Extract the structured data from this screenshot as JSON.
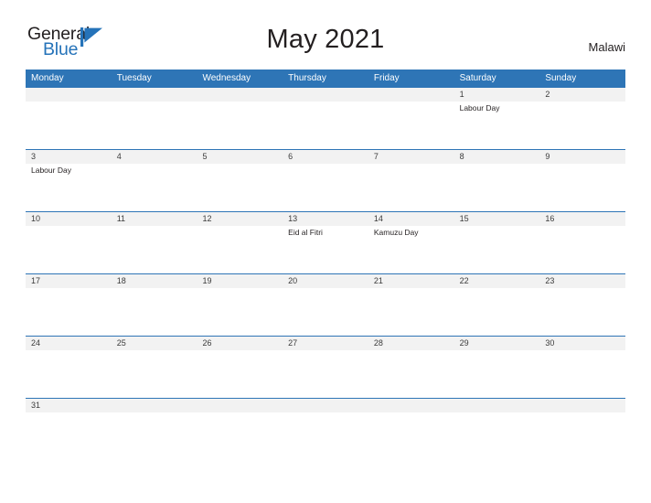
{
  "logo": {
    "word_one": "General",
    "word_two": "Blue",
    "flag_icon": "flag-triangle-icon",
    "dark_color": "#231f20",
    "blue_color": "#2573b9"
  },
  "header": {
    "title": "May 2021",
    "country": "Malawi"
  },
  "theme": {
    "header_blue": "#2e75b6",
    "row_gray": "#f2f2f2",
    "rule_blue": "#2e75b6",
    "text_dark": "#231f20"
  },
  "calendar": {
    "month": "May",
    "year": "2021",
    "weekday_headers": [
      "Monday",
      "Tuesday",
      "Wednesday",
      "Thursday",
      "Friday",
      "Saturday",
      "Sunday"
    ],
    "weeks": [
      {
        "days": [
          {
            "number": "",
            "events": []
          },
          {
            "number": "",
            "events": []
          },
          {
            "number": "",
            "events": []
          },
          {
            "number": "",
            "events": []
          },
          {
            "number": "",
            "events": []
          },
          {
            "number": "1",
            "events": [
              "Labour Day"
            ]
          },
          {
            "number": "2",
            "events": []
          }
        ]
      },
      {
        "days": [
          {
            "number": "3",
            "events": [
              "Labour Day"
            ]
          },
          {
            "number": "4",
            "events": []
          },
          {
            "number": "5",
            "events": []
          },
          {
            "number": "6",
            "events": []
          },
          {
            "number": "7",
            "events": []
          },
          {
            "number": "8",
            "events": []
          },
          {
            "number": "9",
            "events": []
          }
        ]
      },
      {
        "days": [
          {
            "number": "10",
            "events": []
          },
          {
            "number": "11",
            "events": []
          },
          {
            "number": "12",
            "events": []
          },
          {
            "number": "13",
            "events": [
              "Eid al Fitri"
            ]
          },
          {
            "number": "14",
            "events": [
              "Kamuzu Day"
            ]
          },
          {
            "number": "15",
            "events": []
          },
          {
            "number": "16",
            "events": []
          }
        ]
      },
      {
        "days": [
          {
            "number": "17",
            "events": []
          },
          {
            "number": "18",
            "events": []
          },
          {
            "number": "19",
            "events": []
          },
          {
            "number": "20",
            "events": []
          },
          {
            "number": "21",
            "events": []
          },
          {
            "number": "22",
            "events": []
          },
          {
            "number": "23",
            "events": []
          }
        ]
      },
      {
        "days": [
          {
            "number": "24",
            "events": []
          },
          {
            "number": "25",
            "events": []
          },
          {
            "number": "26",
            "events": []
          },
          {
            "number": "27",
            "events": []
          },
          {
            "number": "28",
            "events": []
          },
          {
            "number": "29",
            "events": []
          },
          {
            "number": "30",
            "events": []
          }
        ]
      },
      {
        "days": [
          {
            "number": "31",
            "events": []
          },
          {
            "number": "",
            "events": []
          },
          {
            "number": "",
            "events": []
          },
          {
            "number": "",
            "events": []
          },
          {
            "number": "",
            "events": []
          },
          {
            "number": "",
            "events": []
          },
          {
            "number": "",
            "events": []
          }
        ]
      }
    ]
  }
}
